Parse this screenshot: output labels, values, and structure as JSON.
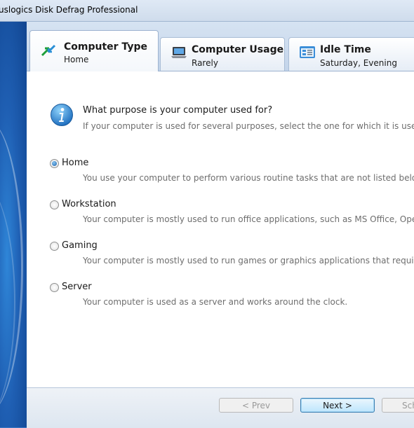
{
  "window": {
    "title": "uslogics Disk Defrag Professional"
  },
  "tabs": [
    {
      "title": "Computer Type",
      "subtitle": "Home",
      "icon": "computer-type-arrows-icon",
      "active": true
    },
    {
      "title": "Computer Usage",
      "subtitle": "Rarely",
      "icon": "laptop-icon",
      "active": false
    },
    {
      "title": "Idle Time",
      "subtitle": "Saturday, Evening",
      "icon": "calendar-card-icon",
      "active": false
    }
  ],
  "main": {
    "info_icon": "info-icon",
    "question": "What purpose is your computer used for?",
    "hint": "If your computer is used for several purposes, select the one for which it is used most of th",
    "options": [
      {
        "label": "Home",
        "description": "You use your computer to perform various routine tasks that are not listed below.",
        "selected": true
      },
      {
        "label": "Workstation",
        "description": "Your computer is mostly used to run office applications, such as MS Office, Open Office e",
        "selected": false
      },
      {
        "label": "Gaming",
        "description": "Your computer is mostly used to run games or graphics applications that require a lot of s",
        "selected": false
      },
      {
        "label": "Server",
        "description": "Your computer is used as a server and works around the clock.",
        "selected": false
      }
    ]
  },
  "footer": {
    "prev_label": "< Prev",
    "next_label": "Next >",
    "third_label": "Sch"
  },
  "colors": {
    "accent_blue": "#3b78c4",
    "icon_green": "#1e9e3a",
    "radio_fill": "#1b5fa8"
  }
}
